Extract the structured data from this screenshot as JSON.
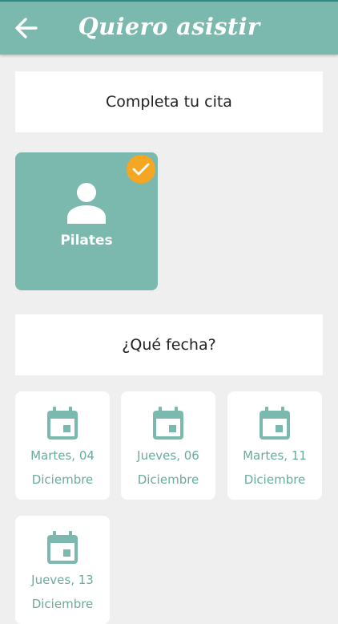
{
  "header": {
    "title": "Quiero asistir"
  },
  "step1": {
    "label": "Completa tu cita"
  },
  "service": {
    "name": "Pilates",
    "selected": true
  },
  "step2": {
    "label": "¿Qué fecha?"
  },
  "dates": [
    {
      "day": "Martes, 04",
      "month": "Diciembre"
    },
    {
      "day": "Jueves, 06",
      "month": "Diciembre"
    },
    {
      "day": "Martes, 11",
      "month": "Diciembre"
    },
    {
      "day": "Jueves, 13",
      "month": "Diciembre"
    }
  ],
  "colors": {
    "accent": "#7bb8ad",
    "accent_text": "#6aab9f",
    "check": "#f5a623",
    "background": "#efefef"
  },
  "icons": {
    "back": "arrow-left-icon",
    "person": "person-icon",
    "check": "check-icon",
    "calendar": "calendar-icon"
  }
}
